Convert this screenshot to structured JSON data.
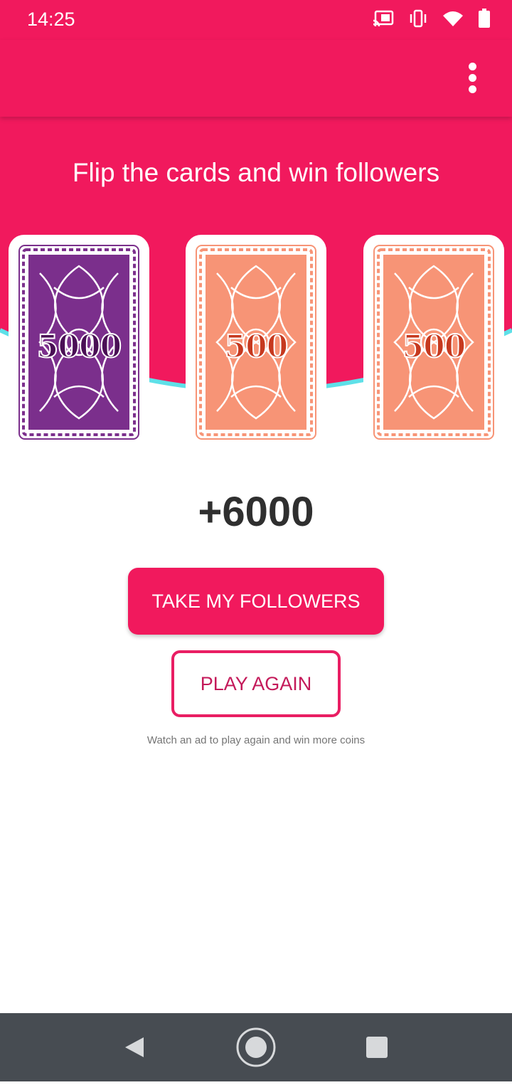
{
  "status_bar": {
    "time": "14:25",
    "icons": [
      "cast-icon",
      "vibrate-icon",
      "wifi-icon",
      "battery-icon"
    ]
  },
  "app_bar": {
    "menu_icon": "more-vert-icon"
  },
  "game": {
    "headline": "Flip the cards and win followers",
    "cards": [
      {
        "value": "5000",
        "color": "#7b2f8c",
        "text_color": "#4a0f55"
      },
      {
        "value": "500",
        "color": "#f79476",
        "text_color": "#c6391f"
      },
      {
        "value": "500",
        "color": "#f79476",
        "text_color": "#c6391f"
      }
    ],
    "total": "+6000",
    "take_button": "TAKE MY FOLLOWERS",
    "play_again_button": "PLAY AGAIN",
    "hint": "Watch an ad to play again and win more coins"
  },
  "nav_bar": {
    "buttons": [
      "back-icon",
      "home-icon",
      "recents-icon"
    ]
  },
  "colors": {
    "primary": "#f1195d",
    "accent_wave": "#5ee0e8",
    "nav_bar": "#474c52"
  }
}
